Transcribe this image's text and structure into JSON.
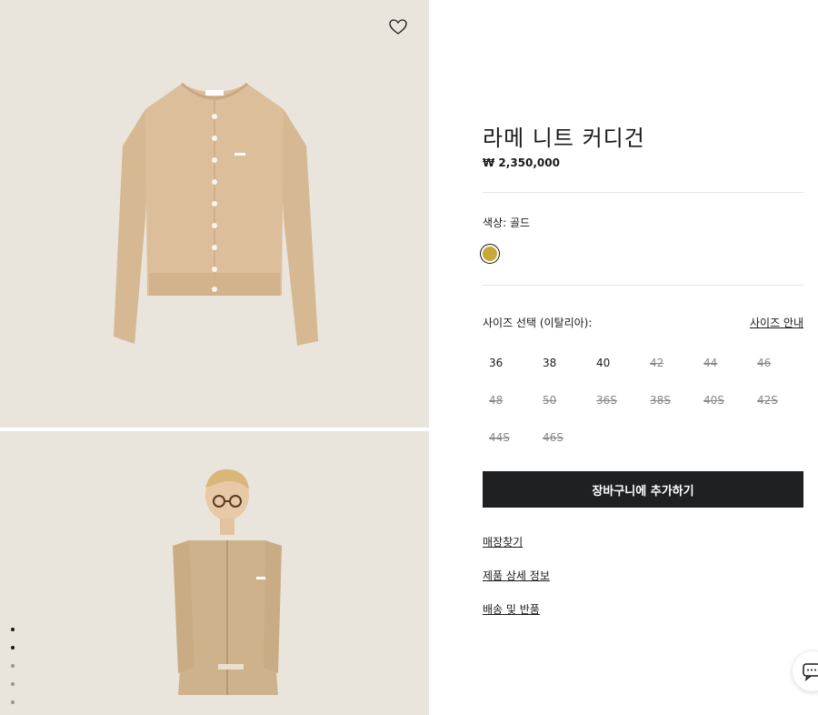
{
  "product": {
    "title": "라메 니트 커디건",
    "price": "₩ 2,350,000"
  },
  "color": {
    "label": "색상:  골드",
    "swatch_hex": "#c9a737"
  },
  "size": {
    "label": "사이즈 선택 (이탈리아):",
    "guide_link": "사이즈 안내",
    "options": [
      {
        "label": "36",
        "available": true
      },
      {
        "label": "38",
        "available": true
      },
      {
        "label": "40",
        "available": true
      },
      {
        "label": "42",
        "available": false
      },
      {
        "label": "44",
        "available": false
      },
      {
        "label": "46",
        "available": false
      },
      {
        "label": "48",
        "available": false
      },
      {
        "label": "50",
        "available": false
      },
      {
        "label": "36S",
        "available": false
      },
      {
        "label": "38S",
        "available": false
      },
      {
        "label": "40S",
        "available": false
      },
      {
        "label": "42S",
        "available": false
      },
      {
        "label": "44S",
        "available": false
      },
      {
        "label": "46S",
        "available": false
      }
    ]
  },
  "actions": {
    "add_to_cart": "장바구니에 추가하기",
    "links": [
      "매장찾기",
      "제품 상세 정보",
      "배송 및 반품"
    ]
  },
  "icons": {
    "favorite": "heart-icon",
    "chat": "chat-icon"
  },
  "gallery": {
    "dots": 5,
    "active_dot": 1
  }
}
